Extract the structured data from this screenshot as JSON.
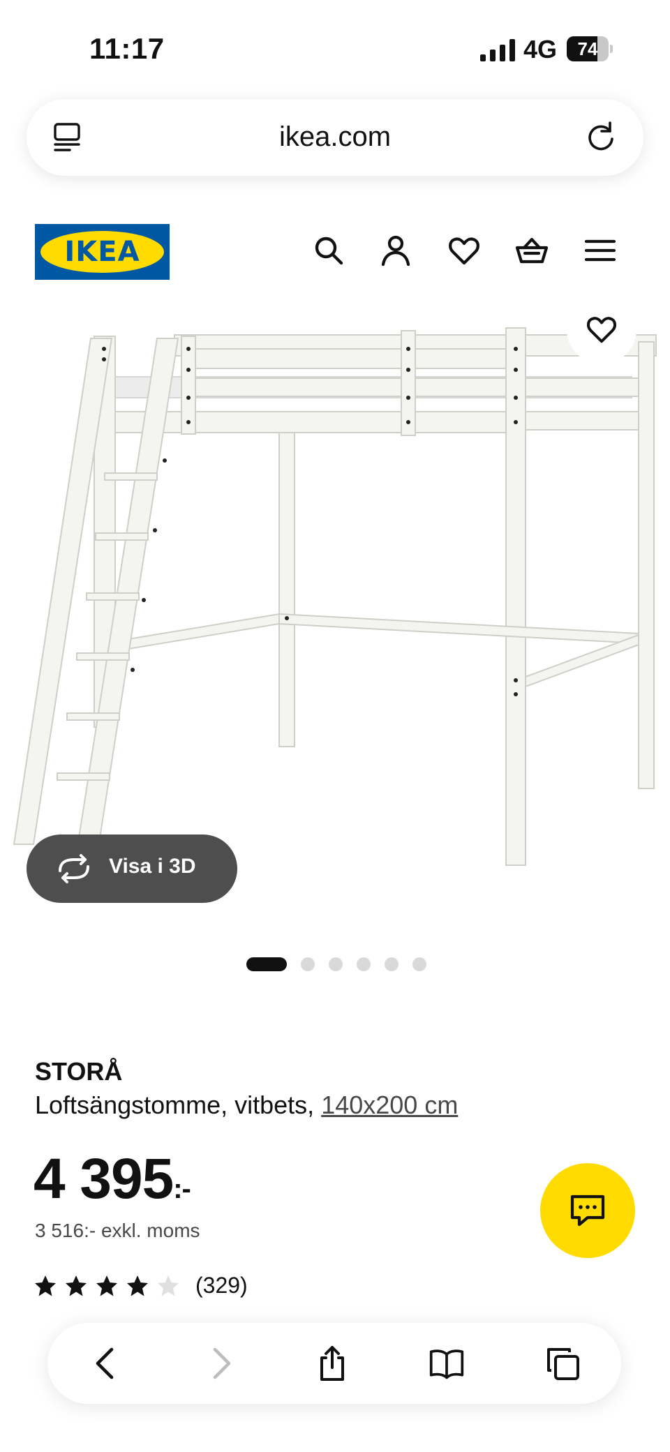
{
  "status": {
    "time": "11:17",
    "network": "4G",
    "battery_percent": 74,
    "battery_label": "74"
  },
  "browser": {
    "url": "ikea.com"
  },
  "header": {
    "logo_text": "IKEA",
    "icons": [
      "search-icon",
      "account-icon",
      "favorites-icon",
      "cart-icon",
      "menu-icon"
    ]
  },
  "gallery": {
    "view3d_label": "Visa i 3D",
    "slide_count": 6,
    "active_slide": 1
  },
  "product": {
    "name": "STORÅ",
    "description": "Loftsängstomme, vitbets, ",
    "size": "140x200 cm",
    "price": "4 395",
    "price_suffix": ":-",
    "price_ex_vat": "3 516:- exkl. moms",
    "rating": 4,
    "rating_max": 5,
    "review_count": "(329)"
  },
  "colors": {
    "ikea_blue": "#0058a3",
    "ikea_yellow": "#ffdb00",
    "text": "#111111",
    "muted": "#484848"
  }
}
